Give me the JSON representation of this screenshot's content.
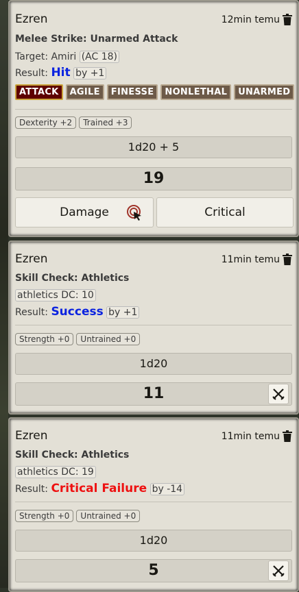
{
  "messages": [
    {
      "sender": "Ezren",
      "time": "12min temu",
      "title": "Melee Strike: Unarmed Attack",
      "target_label": "Target: Amiri",
      "target_ac": "(AC 18)",
      "result_label": "Result:",
      "result_value": "Hit",
      "result_by": "by +1",
      "tags": [
        "ATTACK",
        "AGILE",
        "FINESSE",
        "NONLETHAL",
        "UNARMED"
      ],
      "modifiers": [
        "Dexterity +2",
        "Trained +3"
      ],
      "formula": "1d20 + 5",
      "total": "19",
      "damage_label": "Damage",
      "critical_label": "Critical"
    },
    {
      "sender": "Ezren",
      "time": "11min temu",
      "title": "Skill Check: Athletics",
      "dc": "athletics DC: 10",
      "result_label": "Result:",
      "result_value": "Success",
      "result_by": "by +1",
      "modifiers": [
        "Strength +0",
        "Untrained +0"
      ],
      "formula": "1d20",
      "total": "11"
    },
    {
      "sender": "Ezren",
      "time": "11min temu",
      "title": "Skill Check: Athletics",
      "dc": "athletics DC: 19",
      "result_label": "Result:",
      "result_value": "Critical Failure",
      "result_by": "by -14",
      "modifiers": [
        "Strength +0",
        "Untrained +0"
      ],
      "formula": "1d20",
      "total": "5"
    }
  ],
  "colors": {
    "hit": "#0b23e0",
    "success": "#0b23e0",
    "critical_failure": "#ee1111",
    "attack_tag": "#5e0000",
    "trait_tag": "#6d5a48"
  },
  "icons": {
    "delete": "trash-icon",
    "damage": "target-cursor-icon",
    "reroll": "crossed-swords-icon"
  }
}
